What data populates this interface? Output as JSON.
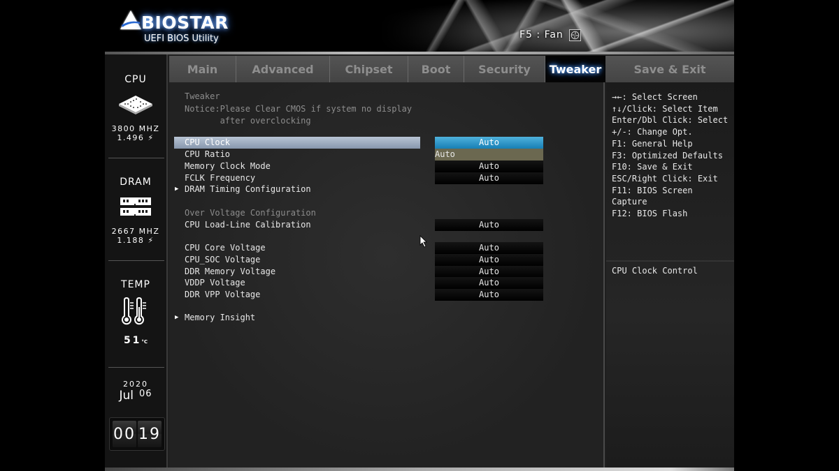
{
  "header": {
    "brand": "BIOSTAR",
    "subtitle": "UEFI BIOS Utility",
    "fan_hint": "F5 : Fan"
  },
  "tabs": [
    {
      "label": "Main",
      "active": false
    },
    {
      "label": "Advanced",
      "active": false
    },
    {
      "label": "Chipset",
      "active": false
    },
    {
      "label": "Boot",
      "active": false
    },
    {
      "label": "Security",
      "active": false
    },
    {
      "label": "Tweaker",
      "active": true
    },
    {
      "label": "Save & Exit",
      "active": false
    }
  ],
  "sidebar": {
    "cpu": {
      "title": "CPU",
      "freq": "3800 MHZ",
      "volt": "1.496 ⚡"
    },
    "dram": {
      "title": "DRAM",
      "freq": "2667 MHZ",
      "volt": "1.188 ⚡"
    },
    "temp": {
      "title": "TEMP",
      "value": "51",
      "unit": "°C"
    },
    "date": {
      "year": "2020",
      "month": "Jul",
      "day": "06"
    },
    "time": {
      "hour": "00",
      "minute": "19"
    }
  },
  "main": {
    "title": "Tweaker",
    "notice": "Notice:Please Clear CMOS if system no display\n       after overclocking",
    "items": [
      {
        "label": "CPU Clock",
        "value": "Auto",
        "selected": true
      },
      {
        "label": "CPU Ratio",
        "value": "Auto",
        "highlight": true
      },
      {
        "label": "Memory Clock Mode",
        "value": "Auto"
      },
      {
        "label": "FCLK Frequency",
        "value": "Auto"
      },
      {
        "label": "DRAM Timing Configuration",
        "submenu": true
      },
      {
        "label": "Over Voltage Configuration",
        "header": true
      },
      {
        "label": "CPU Load-Line Calibration",
        "value": "Auto"
      },
      {
        "label": "CPU Core Voltage",
        "value": "Auto"
      },
      {
        "label": "CPU_SOC Voltage",
        "value": "Auto"
      },
      {
        "label": "DDR Memory Voltage",
        "value": "Auto"
      },
      {
        "label": "VDDP Voltage",
        "value": "Auto"
      },
      {
        "label": "DDR VPP Voltage",
        "value": "Auto"
      },
      {
        "label": "Memory Insight",
        "submenu": true
      }
    ]
  },
  "help": {
    "keys": [
      "→←: Select Screen",
      "↑↓/Click: Select Item",
      "Enter/Dbl Click: Select",
      "+/-: Change Opt.",
      "F1: General Help",
      "F3: Optimized Defaults",
      "F10: Save & Exit",
      "ESC/Right Click: Exit",
      "F11: BIOS Screen",
      "Capture",
      "F12: BIOS Flash"
    ],
    "description": "CPU Clock Control"
  }
}
